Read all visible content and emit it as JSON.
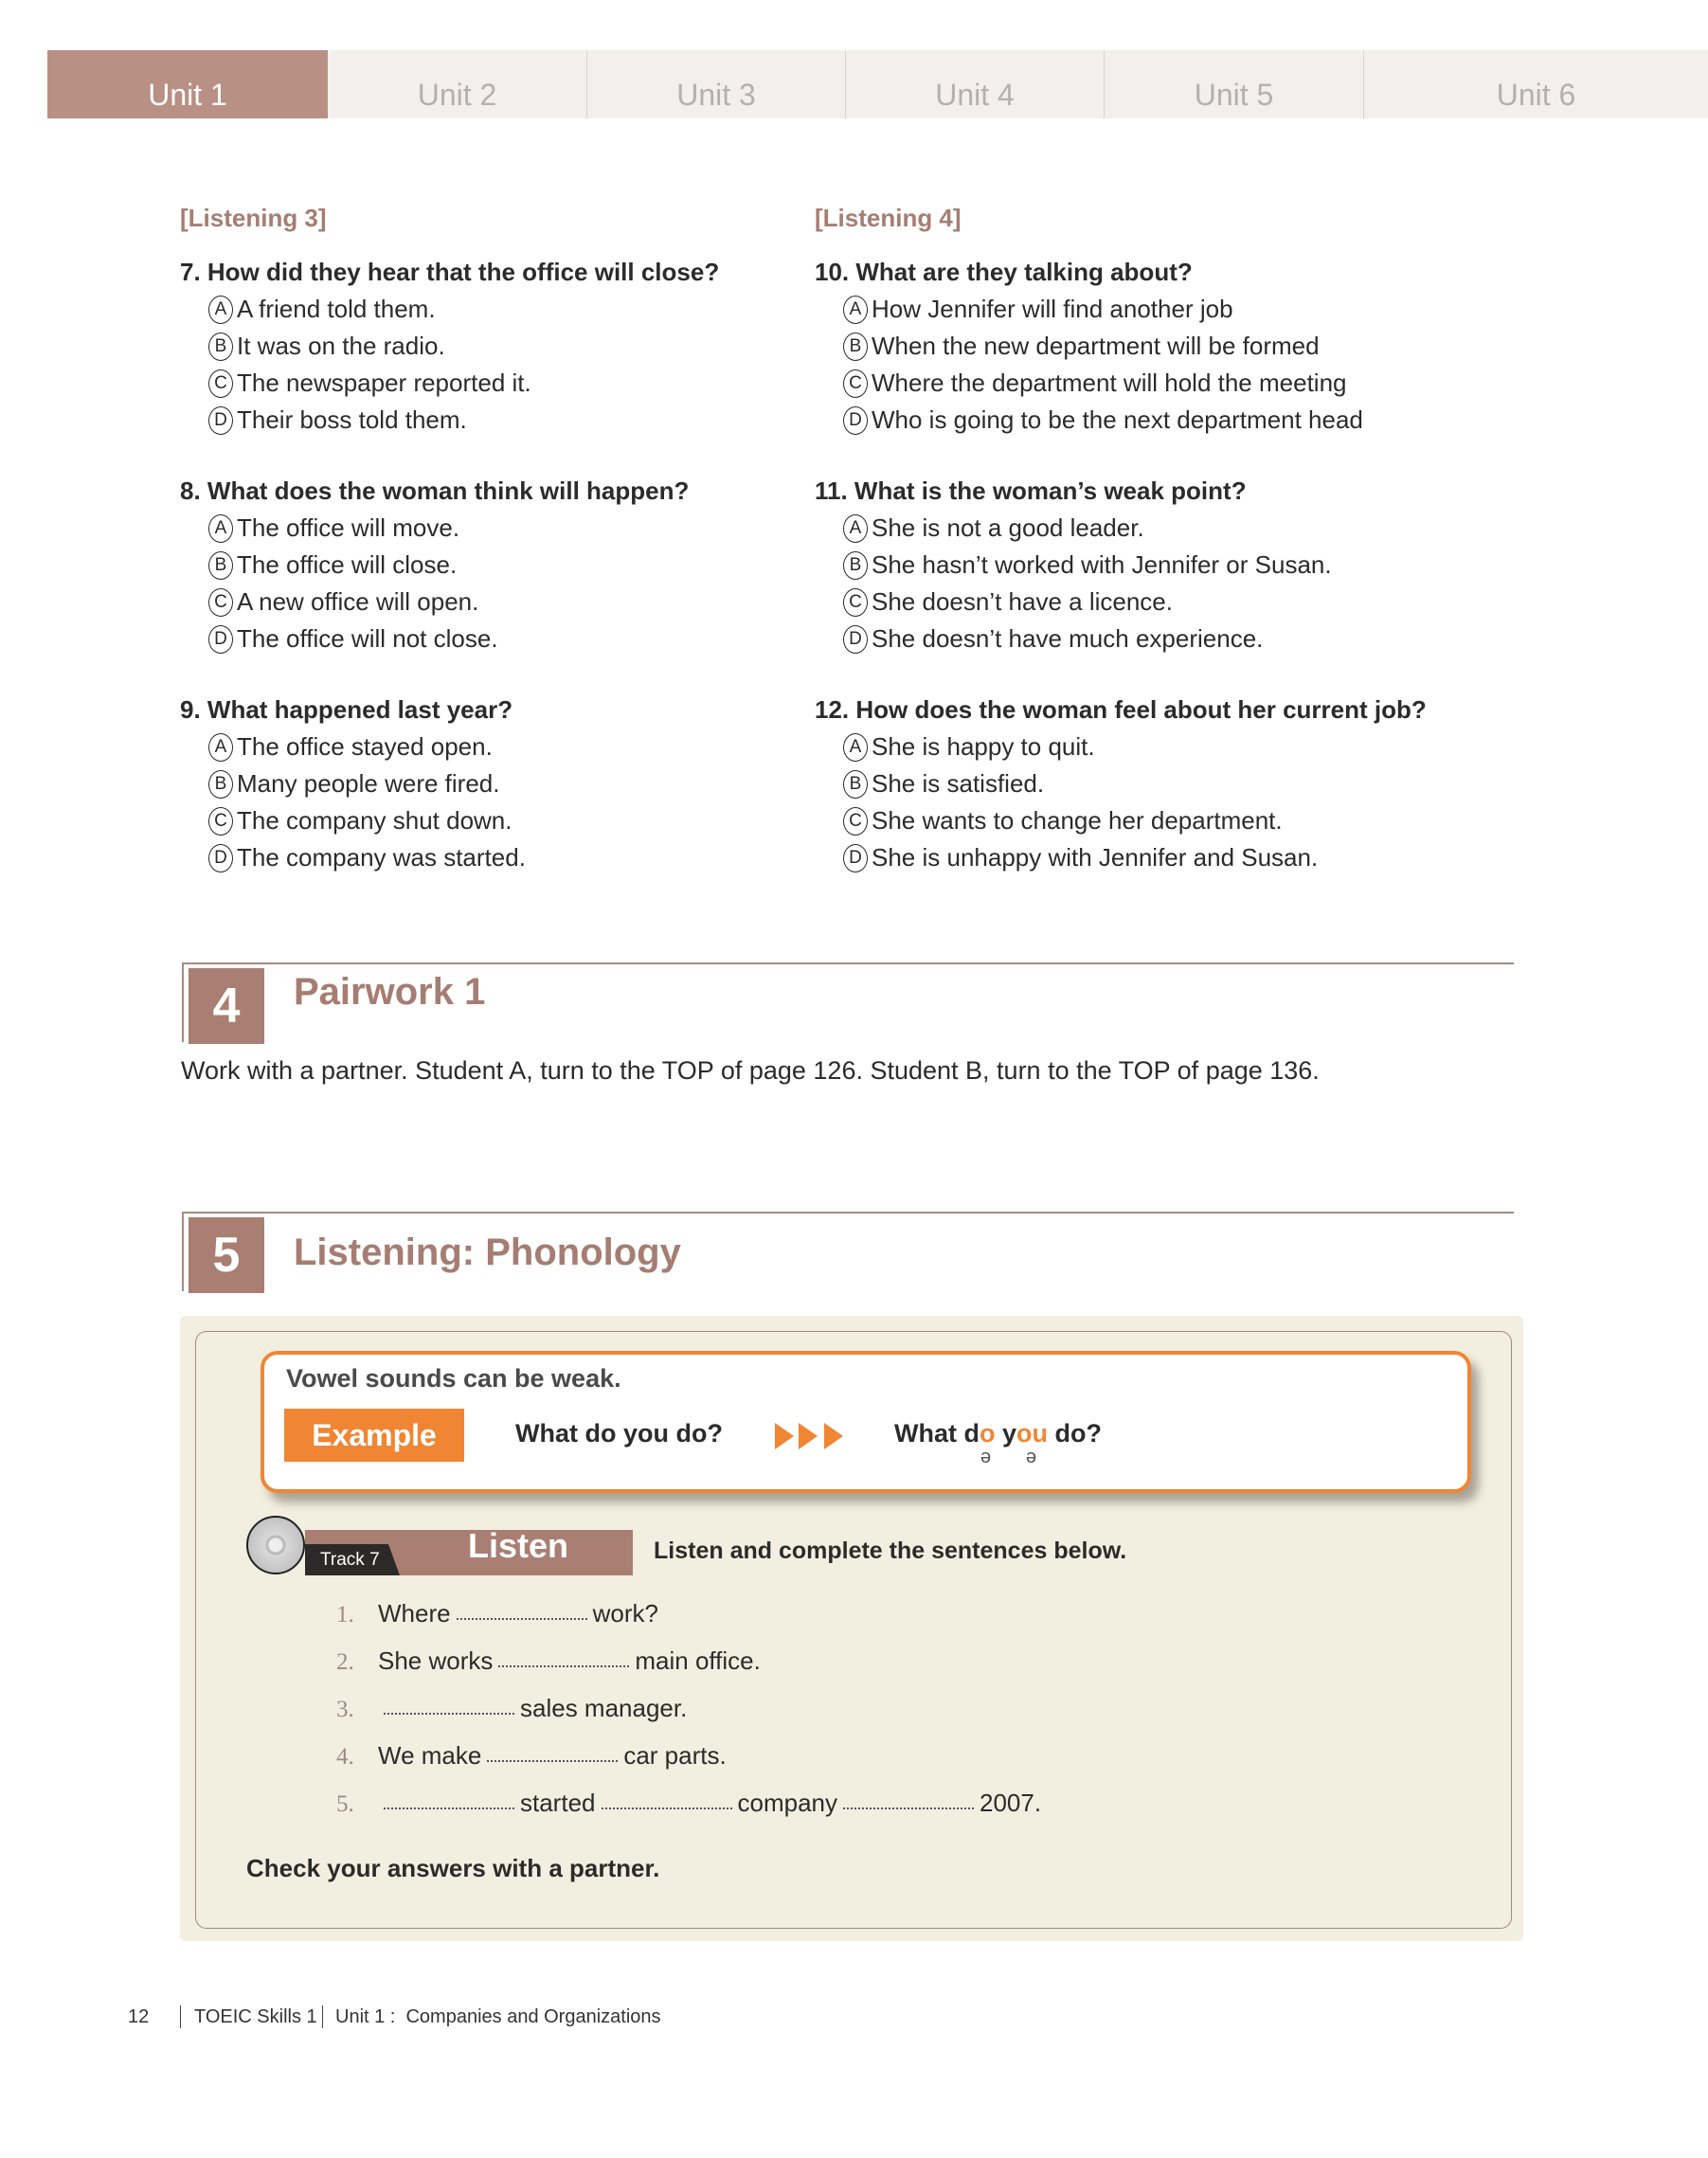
{
  "tabs": [
    {
      "label": "Unit 1",
      "active": true
    },
    {
      "label": "Unit 2",
      "active": false
    },
    {
      "label": "Unit 3",
      "active": false
    },
    {
      "label": "Unit 4",
      "active": false
    },
    {
      "label": "Unit 5",
      "active": false
    },
    {
      "label": "Unit 6",
      "active": false
    }
  ],
  "listening3": {
    "heading": "[Listening 3]",
    "questions": [
      {
        "text": "7. How did they hear that the office will close?",
        "options": [
          {
            "letter": "A",
            "text": "A friend told them."
          },
          {
            "letter": "B",
            "text": "It was on the radio."
          },
          {
            "letter": "C",
            "text": "The newspaper reported it."
          },
          {
            "letter": "D",
            "text": "Their boss told them."
          }
        ]
      },
      {
        "text": "8. What does the woman think will happen?",
        "options": [
          {
            "letter": "A",
            "text": "The office will move."
          },
          {
            "letter": "B",
            "text": "The office will close."
          },
          {
            "letter": "C",
            "text": "A new office will open."
          },
          {
            "letter": "D",
            "text": "The office will not close."
          }
        ]
      },
      {
        "text": "9. What happened last year?",
        "options": [
          {
            "letter": "A",
            "text": "The office stayed open."
          },
          {
            "letter": "B",
            "text": "Many people were fired."
          },
          {
            "letter": "C",
            "text": "The company shut down."
          },
          {
            "letter": "D",
            "text": "The company was started."
          }
        ]
      }
    ]
  },
  "listening4": {
    "heading": "[Listening 4]",
    "questions": [
      {
        "text": "10. What are they talking about?",
        "options": [
          {
            "letter": "A",
            "text": "How Jennifer will find another job"
          },
          {
            "letter": "B",
            "text": "When the new department will be formed"
          },
          {
            "letter": "C",
            "text": "Where the department will hold the meeting"
          },
          {
            "letter": "D",
            "text": "Who is going to be the next department head"
          }
        ]
      },
      {
        "text": "11. What is the woman’s weak point?",
        "options": [
          {
            "letter": "A",
            "text": "She is not a good leader."
          },
          {
            "letter": "B",
            "text": "She hasn’t worked with Jennifer or Susan."
          },
          {
            "letter": "C",
            "text": "She doesn’t have a licence."
          },
          {
            "letter": "D",
            "text": "She doesn’t have much experience."
          }
        ]
      },
      {
        "text": "12. How does the woman feel about her current job?",
        "options": [
          {
            "letter": "A",
            "text": "She is happy to quit."
          },
          {
            "letter": "B",
            "text": "She is satisfied."
          },
          {
            "letter": "C",
            "text": "She wants to change her department."
          },
          {
            "letter": "D",
            "text": "She is unhappy with Jennifer and Susan."
          }
        ]
      }
    ]
  },
  "section4": {
    "number": "4",
    "title": "Pairwork 1",
    "instruction": "Work with a partner. Student A, turn to the TOP of page 126. Student B, turn to the TOP of page 136."
  },
  "section5": {
    "number": "5",
    "title": "Listening: Phonology",
    "rule": "Vowel sounds can be weak.",
    "example_label": "Example",
    "example_original": "What do you do?",
    "example_weak": {
      "p1": "What d",
      "h1": "o",
      "p2": " y",
      "h2": "ou",
      "p3": " do?",
      "schwa": "ə"
    },
    "track_label": "Track 7",
    "listen_label": "Listen",
    "listen_instruction": "Listen and complete the sentences below.",
    "sentences": [
      {
        "num": "1.",
        "parts": [
          "Where",
          "_",
          "work?"
        ]
      },
      {
        "num": "2.",
        "parts": [
          "She works",
          "_",
          "main office."
        ]
      },
      {
        "num": "3.",
        "parts": [
          "_",
          "sales manager."
        ]
      },
      {
        "num": "4.",
        "parts": [
          "We make",
          "_",
          "car parts."
        ]
      },
      {
        "num": "5.",
        "parts": [
          "_",
          "started",
          "_",
          "company",
          "_",
          "2007."
        ]
      }
    ],
    "check": "Check your answers with a partner."
  },
  "footer": {
    "page": "12",
    "book": "TOEIC Skills 1",
    "unit": "Unit 1 :  Companies and Organizations"
  },
  "colors": {
    "accent": "#a97f73",
    "tab_active": "#b89084",
    "orange": "#f08633",
    "panel_bg": "#f3efe0"
  }
}
